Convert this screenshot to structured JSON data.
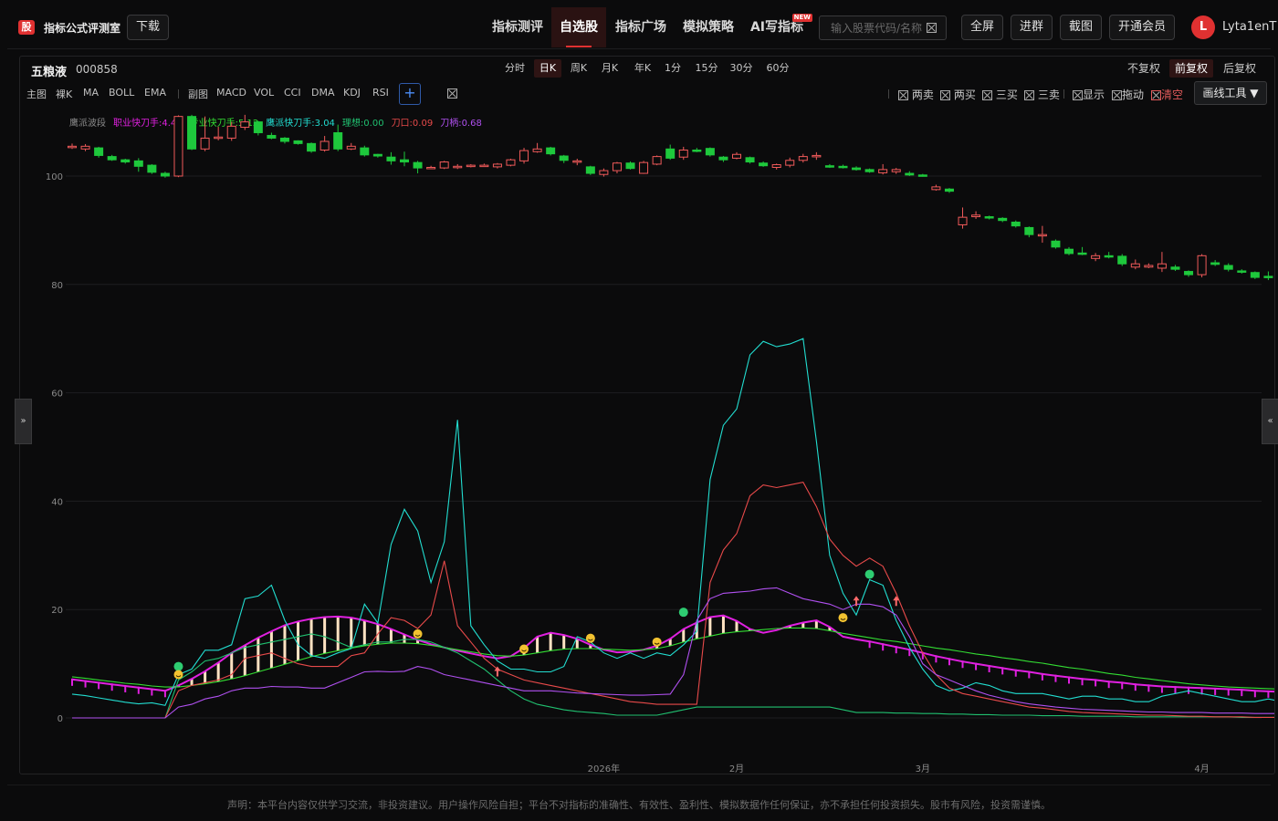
{
  "header": {
    "logo_text": "股",
    "app_title": "指标公式评测室",
    "download_label": "下载",
    "nav": [
      "指标测评",
      "自选股",
      "指标广场",
      "模拟策略",
      "AI写指标"
    ],
    "nav_active": "自选股",
    "new_badge": "NEW",
    "search_placeholder": "输入股票代码/名称",
    "buttons": [
      "全屏",
      "进群",
      "截图",
      "开通会员"
    ],
    "avatar_letter": "L",
    "username": "Lyta1enT"
  },
  "toolbar": {
    "stock_name": "五粮液",
    "stock_code": "000858",
    "periods": [
      "分时",
      "日K",
      "周K",
      "月K",
      "年K",
      "1分",
      "15分",
      "30分",
      "60分"
    ],
    "period_active": "日K",
    "adjust": [
      "不复权",
      "前复权",
      "后复权"
    ],
    "adjust_active": "前复权",
    "main_label": "主图",
    "main_indicators": [
      "裸K",
      "MA",
      "BOLL",
      "EMA"
    ],
    "sub_label": "副图",
    "sub_indicators": [
      "MACD",
      "VOL",
      "CCI",
      "DMA",
      "KDJ",
      "RSI"
    ],
    "plus": "+",
    "tools": [
      "两卖",
      "两买",
      "三买",
      "三卖",
      "显示",
      "拖动",
      "清空"
    ],
    "draw_tools": "画线工具 ▼"
  },
  "sidetabs": {
    "left": "»",
    "right": "«"
  },
  "footer": {
    "disclaimer": "声明：本平台内容仅供学习交流，非投资建议。用户操作风险自担；平台不对指标的准确性、有效性、盈利性、模拟数据作任何保证，亦不承担任何投资损失。股市有风险，投资需谨慎。"
  },
  "chart_data": {
    "type": "candlestick+line",
    "y_ticks": [
      0,
      20,
      40,
      60,
      80,
      100,
      120
    ],
    "ylim": [
      0,
      120
    ],
    "x_ticks": [
      {
        "label": "2026年",
        "index": 40
      },
      {
        "label": "2月",
        "index": 50
      },
      {
        "label": "3月",
        "index": 64
      },
      {
        "label": "4月",
        "index": 85
      }
    ],
    "grid": true,
    "legend": {
      "title": "鹰派波段",
      "items": [
        {
          "label": "职业快刀手:4.43",
          "color": "#e020e0"
        },
        {
          "label": "专业快刀手:5.12",
          "color": "#33dd33"
        },
        {
          "label": "鹰派快刀手:3.04",
          "color": "#22ddd0"
        },
        {
          "label": "理想:0.00",
          "color": "#20c070"
        },
        {
          "label": "刀口:0.09",
          "color": "#e84a4a"
        },
        {
          "label": "刀柄:0.68",
          "color": "#b050f0"
        }
      ]
    },
    "colors": {
      "up": "#f05a5a",
      "down": "#1ec83c"
    },
    "candles": [
      [
        105.5,
        105.5,
        105.0,
        106.0
      ],
      [
        105.0,
        105.5,
        104.6,
        105.9
      ],
      [
        105.2,
        103.8,
        103.4,
        105.4
      ],
      [
        103.6,
        103.0,
        102.8,
        103.9
      ],
      [
        103.0,
        102.6,
        102.3,
        103.2
      ],
      [
        102.8,
        101.8,
        100.8,
        103.3
      ],
      [
        102.0,
        100.7,
        100.4,
        102.2
      ],
      [
        100.5,
        100.0,
        99.7,
        100.8
      ],
      [
        100.0,
        111.0,
        99.8,
        111.2
      ],
      [
        111.0,
        105.0,
        104.8,
        111.3
      ],
      [
        105.0,
        107.0,
        104.6,
        111.0
      ],
      [
        107.0,
        107.2,
        106.6,
        109.1
      ],
      [
        107.0,
        109.2,
        106.5,
        110.0
      ],
      [
        109.0,
        110.0,
        108.5,
        111.3
      ],
      [
        110.0,
        108.0,
        107.5,
        110.2
      ],
      [
        107.5,
        107.0,
        106.8,
        108.0
      ],
      [
        107.0,
        106.4,
        106.0,
        107.2
      ],
      [
        106.5,
        106.0,
        105.8,
        106.6
      ],
      [
        106.0,
        104.6,
        104.3,
        106.2
      ],
      [
        104.8,
        106.4,
        104.5,
        107.4
      ],
      [
        108.0,
        105.0,
        104.6,
        109.5
      ],
      [
        105.0,
        105.5,
        104.8,
        106.1
      ],
      [
        105.2,
        103.9,
        103.6,
        105.6
      ],
      [
        104.0,
        103.7,
        103.4,
        104.1
      ],
      [
        103.5,
        102.8,
        102.1,
        104.4
      ],
      [
        103.0,
        102.6,
        101.8,
        104.5
      ],
      [
        102.5,
        101.5,
        100.5,
        102.8
      ],
      [
        101.6,
        101.6,
        101.3,
        101.9
      ],
      [
        101.5,
        102.6,
        101.3,
        102.8
      ],
      [
        101.7,
        101.8,
        101.3,
        102.2
      ],
      [
        101.8,
        102.0,
        101.6,
        102.2
      ],
      [
        101.8,
        102.0,
        101.7,
        102.3
      ],
      [
        101.7,
        102.2,
        101.4,
        102.4
      ],
      [
        102.0,
        103.0,
        101.8,
        103.2
      ],
      [
        102.8,
        104.7,
        102.3,
        105.2
      ],
      [
        104.5,
        105.0,
        104.3,
        106.1
      ],
      [
        105.2,
        104.1,
        103.8,
        105.4
      ],
      [
        103.7,
        102.9,
        102.4,
        103.9
      ],
      [
        102.8,
        102.8,
        102.0,
        103.2
      ],
      [
        101.7,
        100.5,
        100.2,
        101.9
      ],
      [
        100.3,
        101.0,
        99.9,
        101.4
      ],
      [
        101.0,
        102.4,
        100.5,
        102.6
      ],
      [
        102.4,
        101.4,
        101.2,
        102.7
      ],
      [
        100.5,
        102.5,
        100.4,
        102.8
      ],
      [
        102.2,
        103.6,
        102.0,
        103.8
      ],
      [
        105.0,
        103.3,
        103.0,
        105.8
      ],
      [
        103.5,
        104.8,
        103.0,
        105.4
      ],
      [
        104.8,
        104.7,
        104.4,
        105.2
      ],
      [
        105.1,
        103.9,
        103.6,
        105.3
      ],
      [
        103.5,
        103.0,
        102.6,
        103.7
      ],
      [
        103.3,
        104.0,
        103.1,
        104.4
      ],
      [
        103.4,
        102.6,
        102.3,
        103.6
      ],
      [
        102.4,
        101.9,
        101.7,
        102.7
      ],
      [
        101.6,
        102.1,
        101.2,
        102.3
      ],
      [
        102.0,
        102.9,
        101.6,
        103.4
      ],
      [
        102.9,
        103.6,
        102.5,
        104.1
      ],
      [
        103.6,
        103.8,
        103.0,
        104.4
      ],
      [
        101.9,
        101.8,
        101.5,
        102.2
      ],
      [
        101.8,
        101.7,
        101.4,
        102.1
      ],
      [
        101.5,
        101.2,
        101.0,
        101.8
      ],
      [
        101.2,
        100.8,
        100.6,
        101.4
      ],
      [
        100.6,
        101.2,
        100.3,
        102.2
      ],
      [
        100.8,
        101.2,
        100.4,
        101.5
      ],
      [
        100.5,
        100.2,
        100.0,
        100.9
      ],
      [
        100.2,
        100.1,
        99.9,
        100.4
      ],
      [
        97.5,
        98.0,
        97.3,
        98.4
      ],
      [
        97.6,
        97.2,
        96.9,
        97.8
      ],
      [
        91.0,
        92.4,
        90.3,
        94.2
      ],
      [
        92.5,
        92.8,
        92.1,
        93.5
      ],
      [
        92.5,
        92.3,
        92.0,
        92.7
      ],
      [
        92.2,
        91.8,
        91.5,
        92.4
      ],
      [
        91.5,
        90.8,
        90.5,
        91.8
      ],
      [
        90.5,
        89.2,
        88.7,
        90.7
      ],
      [
        89.0,
        89.2,
        87.7,
        90.8
      ],
      [
        88.0,
        86.9,
        86.6,
        88.3
      ],
      [
        86.5,
        85.7,
        85.4,
        86.9
      ],
      [
        85.8,
        85.7,
        85.4,
        86.9
      ],
      [
        84.8,
        85.3,
        84.3,
        85.8
      ],
      [
        85.3,
        85.1,
        84.8,
        86.0
      ],
      [
        85.2,
        83.8,
        83.4,
        85.6
      ],
      [
        83.2,
        83.8,
        82.8,
        84.6
      ],
      [
        83.2,
        83.5,
        83.0,
        83.9
      ],
      [
        83.0,
        83.8,
        82.3,
        86.0
      ],
      [
        83.2,
        82.8,
        82.5,
        83.6
      ],
      [
        82.4,
        81.8,
        81.4,
        82.6
      ],
      [
        81.8,
        85.3,
        81.3,
        85.6
      ],
      [
        84.0,
        83.7,
        83.4,
        84.5
      ],
      [
        83.5,
        82.8,
        82.4,
        83.9
      ],
      [
        82.5,
        82.3,
        82.0,
        82.8
      ],
      [
        82.2,
        81.3,
        81.0,
        82.4
      ],
      [
        81.5,
        81.3,
        80.8,
        82.4
      ]
    ],
    "series": [
      {
        "name": "职业快刀手",
        "color": "#e020e0",
        "values": [
          7.1,
          6.8,
          6.5,
          6.2,
          5.9,
          5.6,
          5.3,
          5.0,
          6.0,
          7.2,
          8.6,
          10.2,
          12.0,
          13.4,
          14.8,
          16.0,
          17.1,
          17.8,
          18.3,
          18.6,
          18.7,
          18.5,
          18.0,
          17.3,
          16.4,
          15.4,
          14.4,
          13.6,
          13.0,
          12.4,
          11.9,
          11.4,
          11.0,
          11.4,
          12.9,
          15.0,
          15.7,
          15.3,
          14.6,
          13.5,
          12.6,
          12.1,
          12.2,
          12.6,
          13.3,
          14.6,
          16.4,
          17.6,
          18.6,
          18.9,
          17.9,
          16.4,
          15.7,
          16.2,
          17.0,
          17.6,
          18.0,
          16.8,
          15.0,
          14.5,
          14.1,
          13.6,
          13.1,
          12.6,
          12.0,
          11.4,
          10.9,
          10.4,
          10.0,
          9.6,
          9.2,
          8.8,
          8.5,
          8.1,
          7.8,
          7.5,
          7.2,
          7.0,
          6.7,
          6.5,
          6.2,
          6.0,
          5.8,
          5.7,
          5.6,
          5.5,
          5.4,
          5.3,
          5.2,
          5.0,
          4.9,
          4.8,
          4.6
        ]
      },
      {
        "name": "专业快刀手",
        "color": "#33dd33",
        "values": [
          7.6,
          7.3,
          7.0,
          6.7,
          6.4,
          6.2,
          5.9,
          5.7,
          5.7,
          6.0,
          6.3,
          6.7,
          7.2,
          7.8,
          8.5,
          9.2,
          9.9,
          10.6,
          11.3,
          11.9,
          12.4,
          12.9,
          13.3,
          13.6,
          13.8,
          13.8,
          13.7,
          13.4,
          13.0,
          12.6,
          12.2,
          11.8,
          11.5,
          11.4,
          11.6,
          12.0,
          12.4,
          12.7,
          12.8,
          12.8,
          12.7,
          12.6,
          12.5,
          12.6,
          12.8,
          13.3,
          14.0,
          14.6,
          15.1,
          15.6,
          15.9,
          16.1,
          16.3,
          16.5,
          16.6,
          16.6,
          16.5,
          16.1,
          15.6,
          15.2,
          14.8,
          14.4,
          14.1,
          13.7,
          13.3,
          12.9,
          12.6,
          12.2,
          11.8,
          11.5,
          11.1,
          10.8,
          10.4,
          10.1,
          9.7,
          9.3,
          9.0,
          8.6,
          8.2,
          7.9,
          7.5,
          7.2,
          6.9,
          6.6,
          6.3,
          6.1,
          5.9,
          5.7,
          5.6,
          5.5,
          5.4,
          5.3,
          5.2
        ]
      },
      {
        "name": "鹰派快刀手",
        "color": "#22ddd0",
        "values": [
          4.4,
          4.1,
          3.7,
          3.3,
          2.9,
          2.6,
          2.8,
          2.3,
          8.0,
          9.0,
          12.5,
          12.5,
          13.5,
          22.0,
          22.5,
          24.5,
          18.0,
          13.5,
          11.5,
          11.0,
          12.0,
          12.8,
          21.0,
          17.5,
          32.0,
          38.5,
          34.5,
          25.0,
          32.5,
          55.0,
          17.0,
          13.5,
          10.5,
          9.0,
          9.0,
          8.5,
          8.5,
          9.5,
          15.0,
          14.0,
          12.0,
          11.0,
          12.0,
          11.0,
          12.0,
          11.5,
          13.5,
          16.0,
          44.0,
          54.0,
          57.0,
          67.0,
          69.5,
          68.5,
          69.0,
          70.0,
          51.0,
          30.0,
          23.0,
          19.0,
          25.5,
          24.5,
          18.0,
          13.0,
          9.0,
          6.0,
          5.0,
          5.5,
          6.5,
          6.0,
          5.0,
          4.5,
          4.5,
          4.5,
          4.0,
          3.5,
          4.0,
          4.0,
          3.5,
          3.5,
          3.0,
          3.0,
          4.0,
          4.5,
          5.0,
          4.5,
          4.0,
          3.5,
          3.0,
          3.0,
          3.5,
          3.0
        ]
      },
      {
        "name": "理想",
        "color": "#20c070",
        "values": [
          0.0,
          0.0,
          0.0,
          0.0,
          0.0,
          0.0,
          0.0,
          0.0,
          7.0,
          8.5,
          10.5,
          11.0,
          12.0,
          13.0,
          13.5,
          14.0,
          14.5,
          15.0,
          15.5,
          15.0,
          14.0,
          13.0,
          13.5,
          14.0,
          14.0,
          14.5,
          14.5,
          14.0,
          13.0,
          12.0,
          10.5,
          9.0,
          7.0,
          5.0,
          3.5,
          2.5,
          2.0,
          1.5,
          1.2,
          1.0,
          0.8,
          0.5,
          0.5,
          0.5,
          0.5,
          1.0,
          1.5,
          2.0,
          2.0,
          2.0,
          2.0,
          2.0,
          2.0,
          2.0,
          2.0,
          2.0,
          2.0,
          2.0,
          1.5,
          1.0,
          1.0,
          1.0,
          0.9,
          0.9,
          0.8,
          0.8,
          0.7,
          0.7,
          0.6,
          0.6,
          0.5,
          0.5,
          0.5,
          0.4,
          0.4,
          0.4,
          0.3,
          0.3,
          0.3,
          0.3,
          0.2,
          0.2,
          0.2,
          0.2,
          0.2,
          0.2,
          0.2,
          0.2,
          0.1,
          0.1,
          0.1,
          0.1,
          0.1
        ]
      },
      {
        "name": "刀口",
        "color": "#e84a4a",
        "values": [
          0.0,
          0.0,
          0.0,
          0.0,
          0.0,
          0.0,
          0.0,
          0.0,
          5.0,
          6.0,
          6.5,
          7.0,
          8.0,
          11.0,
          11.5,
          12.0,
          11.0,
          10.0,
          9.5,
          9.5,
          9.5,
          11.5,
          12.0,
          15.5,
          18.5,
          18.0,
          16.5,
          19.0,
          29.0,
          17.0,
          14.0,
          11.0,
          9.0,
          8.0,
          7.0,
          6.5,
          6.0,
          5.5,
          5.0,
          4.5,
          4.0,
          3.5,
          3.0,
          2.8,
          2.5,
          2.5,
          2.5,
          2.5,
          25.0,
          31.0,
          34.0,
          41.0,
          43.0,
          42.5,
          43.0,
          43.5,
          39.0,
          33.0,
          30.0,
          28.0,
          29.5,
          28.0,
          23.0,
          17.0,
          12.0,
          8.0,
          5.5,
          4.5,
          4.0,
          3.5,
          3.0,
          2.5,
          2.0,
          1.8,
          1.5,
          1.2,
          1.0,
          0.9,
          0.8,
          0.7,
          0.6,
          0.5,
          0.5,
          0.4,
          0.3,
          0.3,
          0.2,
          0.2,
          0.2,
          0.1,
          0.1,
          0.1,
          0.1
        ]
      },
      {
        "name": "刀柄",
        "color": "#b050f0",
        "values": [
          0.0,
          0.0,
          0.0,
          0.0,
          0.0,
          0.0,
          0.0,
          0.0,
          2.0,
          2.5,
          3.5,
          4.0,
          5.0,
          5.5,
          5.5,
          5.8,
          5.7,
          5.7,
          5.5,
          5.5,
          6.5,
          7.5,
          8.5,
          8.6,
          8.5,
          8.6,
          9.5,
          9.0,
          8.0,
          7.5,
          7.0,
          6.5,
          6.0,
          5.5,
          5.0,
          5.0,
          5.0,
          4.8,
          4.6,
          4.5,
          4.4,
          4.3,
          4.2,
          4.2,
          4.3,
          4.4,
          8.0,
          18.0,
          22.0,
          23.0,
          23.2,
          23.4,
          23.8,
          24.0,
          23.0,
          22.0,
          21.5,
          21.0,
          20.0,
          21.0,
          21.0,
          20.5,
          19.0,
          15.0,
          10.0,
          8.0,
          7.0,
          6.0,
          5.0,
          4.2,
          3.6,
          3.0,
          2.6,
          2.3,
          2.0,
          1.8,
          1.6,
          1.5,
          1.4,
          1.3,
          1.2,
          1.1,
          1.1,
          1.0,
          1.0,
          1.0,
          0.9,
          0.9,
          0.9,
          0.8,
          0.8,
          0.8
        ]
      }
    ],
    "bars_histogram": {
      "from": 8,
      "to": 59,
      "color": "#ffe2c2"
    },
    "markers": [
      {
        "index": 8,
        "type": "green-dot",
        "value": 9.5
      },
      {
        "index": 8,
        "type": "smile",
        "value": 8.0
      },
      {
        "index": 26,
        "type": "smile",
        "value": 15.5
      },
      {
        "index": 32,
        "type": "arrow-up",
        "value": 8.5
      },
      {
        "index": 34,
        "type": "smile",
        "value": 12.7
      },
      {
        "index": 39,
        "type": "smile",
        "value": 14.7
      },
      {
        "index": 44,
        "type": "smile",
        "value": 14.0
      },
      {
        "index": 46,
        "type": "green-dot",
        "value": 19.5
      },
      {
        "index": 58,
        "type": "smile",
        "value": 18.5
      },
      {
        "index": 59,
        "type": "arrow-up",
        "value": 21.5
      },
      {
        "index": 60,
        "type": "green-dot",
        "value": 26.5
      },
      {
        "index": 62,
        "type": "arrow-up",
        "value": 21.5
      }
    ]
  }
}
